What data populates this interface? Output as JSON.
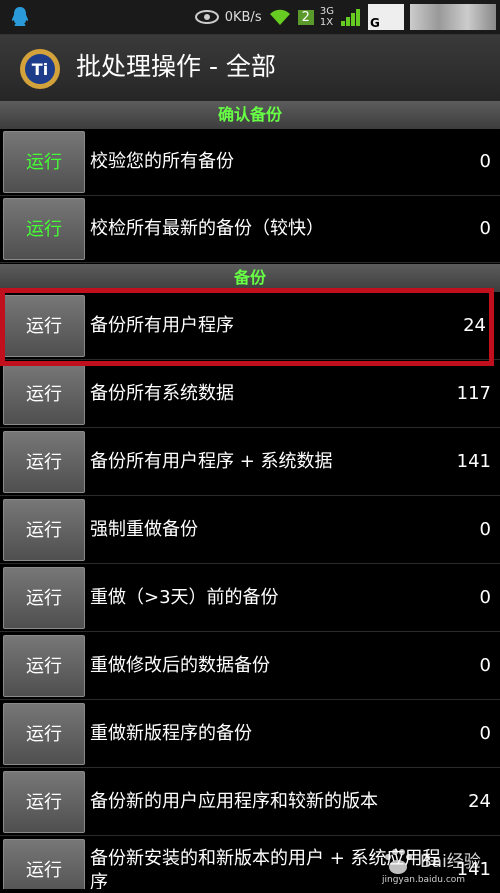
{
  "status": {
    "speed": "0KB/s",
    "sim": "2",
    "net_top": "3G",
    "net_bottom": "1X",
    "carrier_letter": "G"
  },
  "app": {
    "title": "批处理操作 - 全部"
  },
  "sections": {
    "verify": "确认备份",
    "backup": "备份"
  },
  "run_label": "运行",
  "rows": [
    {
      "label": "校验您的所有备份",
      "count": "0"
    },
    {
      "label": "校检所有最新的备份（较快）",
      "count": "0"
    },
    {
      "label": "备份所有用户程序",
      "count": "24"
    },
    {
      "label": "备份所有系统数据",
      "count": "117"
    },
    {
      "label": "备份所有用户程序 + 系统数据",
      "count": "141"
    },
    {
      "label": "强制重做备份",
      "count": "0"
    },
    {
      "label": "重做（>3天）前的备份",
      "count": "0"
    },
    {
      "label": "重做修改后的数据备份",
      "count": "0"
    },
    {
      "label": "重做新版程序的备份",
      "count": "0"
    },
    {
      "label": "备份新的用户应用程序和较新的版本",
      "count": "24"
    },
    {
      "label": "备份新安装的和新版本的用户 + 系统应用程序",
      "count": "141"
    }
  ],
  "watermark": {
    "text": "Bai经验",
    "url": "jingyan.baidu.com"
  },
  "colors": {
    "section_text": "#66ff44",
    "highlight": "#c0101e"
  }
}
